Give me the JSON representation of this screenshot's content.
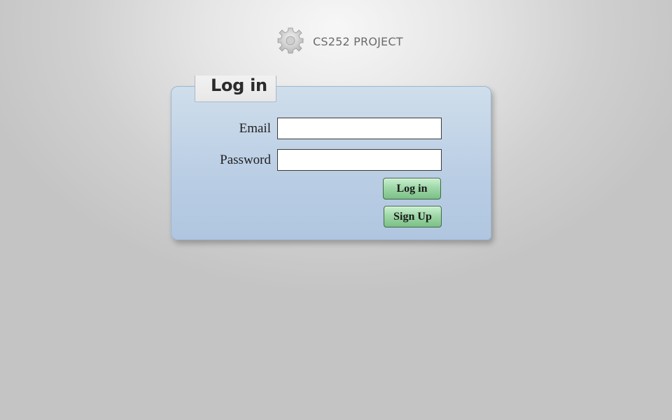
{
  "brand": {
    "name": "CS252 PROJECT",
    "icon": "gear-icon"
  },
  "login_panel": {
    "title": "Log in",
    "email": {
      "label": "Email",
      "value": "",
      "placeholder": ""
    },
    "password": {
      "label": "Password",
      "value": "",
      "placeholder": ""
    },
    "login_button": "Log in",
    "signup_button": "Sign Up"
  },
  "colors": {
    "panel": "#bccfe4",
    "button_green": "#9fd8a8",
    "brand_text": "#6b6b6b"
  }
}
